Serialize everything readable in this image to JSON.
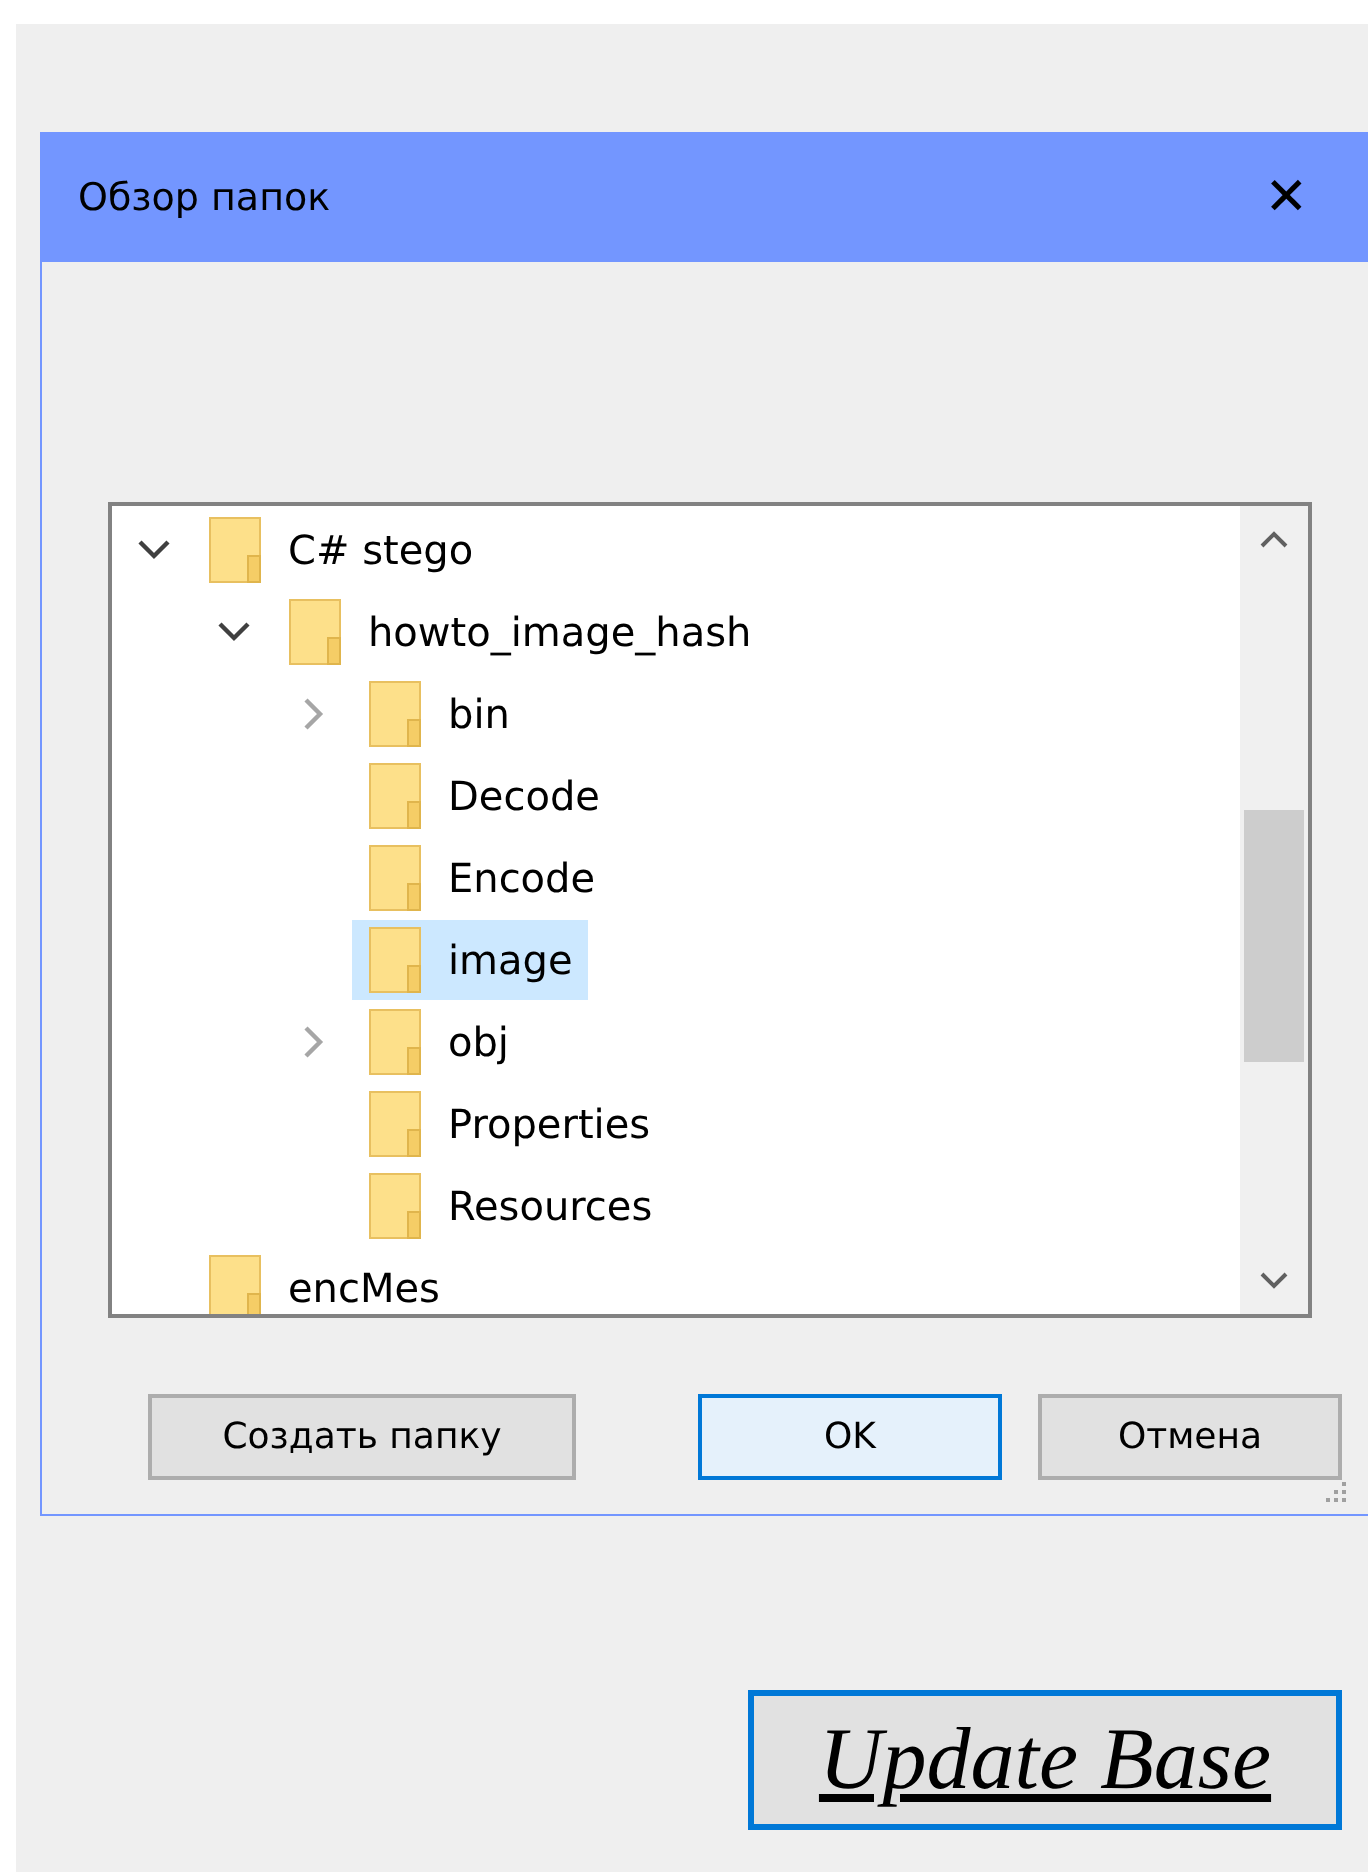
{
  "dialog": {
    "title": "Обзор папок",
    "close": "✕"
  },
  "tree": [
    {
      "kind": "branch",
      "label": "C# stego",
      "expanded": true,
      "selected": false,
      "children": [
        {
          "kind": "branch",
          "label": "howto_image_hash",
          "expanded": true,
          "selected": false,
          "children": [
            {
              "kind": "branch",
              "label": "bin",
              "expanded": false,
              "selected": false
            },
            {
              "kind": "leaf",
              "label": "Decode",
              "selected": false
            },
            {
              "kind": "leaf",
              "label": "Encode",
              "selected": false
            },
            {
              "kind": "leaf",
              "label": "image",
              "selected": true
            },
            {
              "kind": "branch",
              "label": "obj",
              "expanded": false,
              "selected": false
            },
            {
              "kind": "leaf",
              "label": "Properties",
              "selected": false
            },
            {
              "kind": "leaf",
              "label": "Resources",
              "selected": false
            }
          ]
        }
      ]
    },
    {
      "kind": "leaf",
      "label": "encMes",
      "selected": false
    }
  ],
  "buttons": [
    {
      "label": "Создать папку",
      "default": false
    },
    {
      "label": "OK",
      "default": true
    },
    {
      "label": "Отмена",
      "default": false
    }
  ],
  "update_button": {
    "label": "Update Base"
  }
}
